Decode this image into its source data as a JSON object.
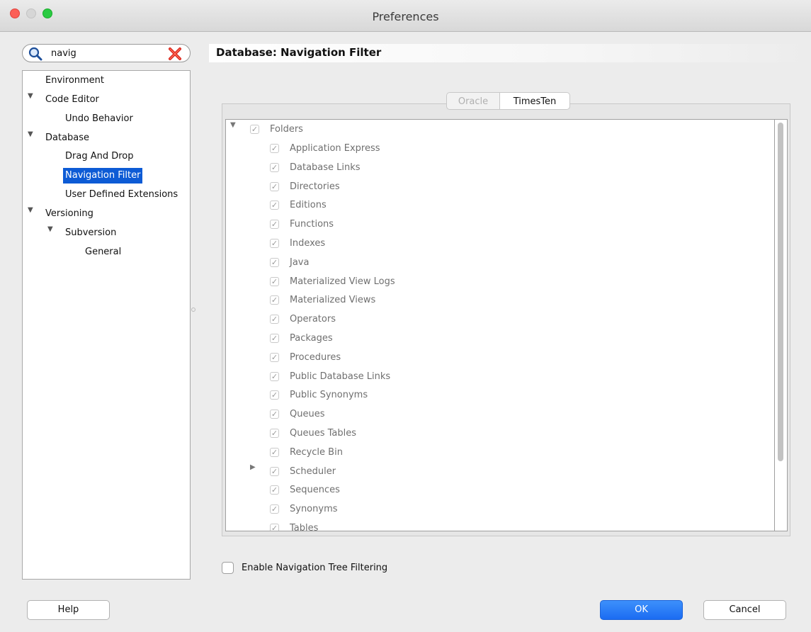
{
  "window": {
    "title": "Preferences"
  },
  "search": {
    "value": "navig",
    "placeholder": ""
  },
  "nav_tree": {
    "items": [
      {
        "label": "Environment"
      },
      {
        "label": "Code Editor",
        "expanded": true
      },
      {
        "label": "Undo Behavior"
      },
      {
        "label": "Database",
        "expanded": true
      },
      {
        "label": "Drag And Drop"
      },
      {
        "label": "Navigation Filter",
        "selected": true
      },
      {
        "label": "User Defined Extensions"
      },
      {
        "label": "Versioning",
        "expanded": true
      },
      {
        "label": "Subversion",
        "expanded": true
      },
      {
        "label": "General"
      }
    ]
  },
  "panel": {
    "title": "Database: Navigation Filter"
  },
  "tabs": [
    {
      "label": "Oracle",
      "enabled": false
    },
    {
      "label": "TimesTen",
      "active": true
    }
  ],
  "folders": {
    "root": {
      "label": "Folders",
      "checked": true,
      "expanded": true
    },
    "items": [
      {
        "label": "Application Express",
        "checked": true
      },
      {
        "label": "Database Links",
        "checked": true
      },
      {
        "label": "Directories",
        "checked": true
      },
      {
        "label": "Editions",
        "checked": true
      },
      {
        "label": "Functions",
        "checked": true
      },
      {
        "label": "Indexes",
        "checked": true
      },
      {
        "label": "Java",
        "checked": true
      },
      {
        "label": "Materialized View Logs",
        "checked": true
      },
      {
        "label": "Materialized Views",
        "checked": true
      },
      {
        "label": "Operators",
        "checked": true
      },
      {
        "label": "Packages",
        "checked": true
      },
      {
        "label": "Procedures",
        "checked": true
      },
      {
        "label": "Public Database Links",
        "checked": true
      },
      {
        "label": "Public Synonyms",
        "checked": true
      },
      {
        "label": "Queues",
        "checked": true
      },
      {
        "label": "Queues Tables",
        "checked": true
      },
      {
        "label": "Recycle Bin",
        "checked": true
      },
      {
        "label": "Scheduler",
        "checked": true,
        "collapsed": true
      },
      {
        "label": "Sequences",
        "checked": true
      },
      {
        "label": "Synonyms",
        "checked": true
      },
      {
        "label": "Tables",
        "checked": true
      }
    ]
  },
  "enable_filtering": {
    "label": "Enable Navigation Tree Filtering",
    "checked": false
  },
  "buttons": {
    "help": "Help",
    "ok": "OK",
    "cancel": "Cancel"
  },
  "colors": {
    "selection": "#0d5bd5",
    "ok_button": "#1b6cf2",
    "check": "#9a9a9a"
  }
}
